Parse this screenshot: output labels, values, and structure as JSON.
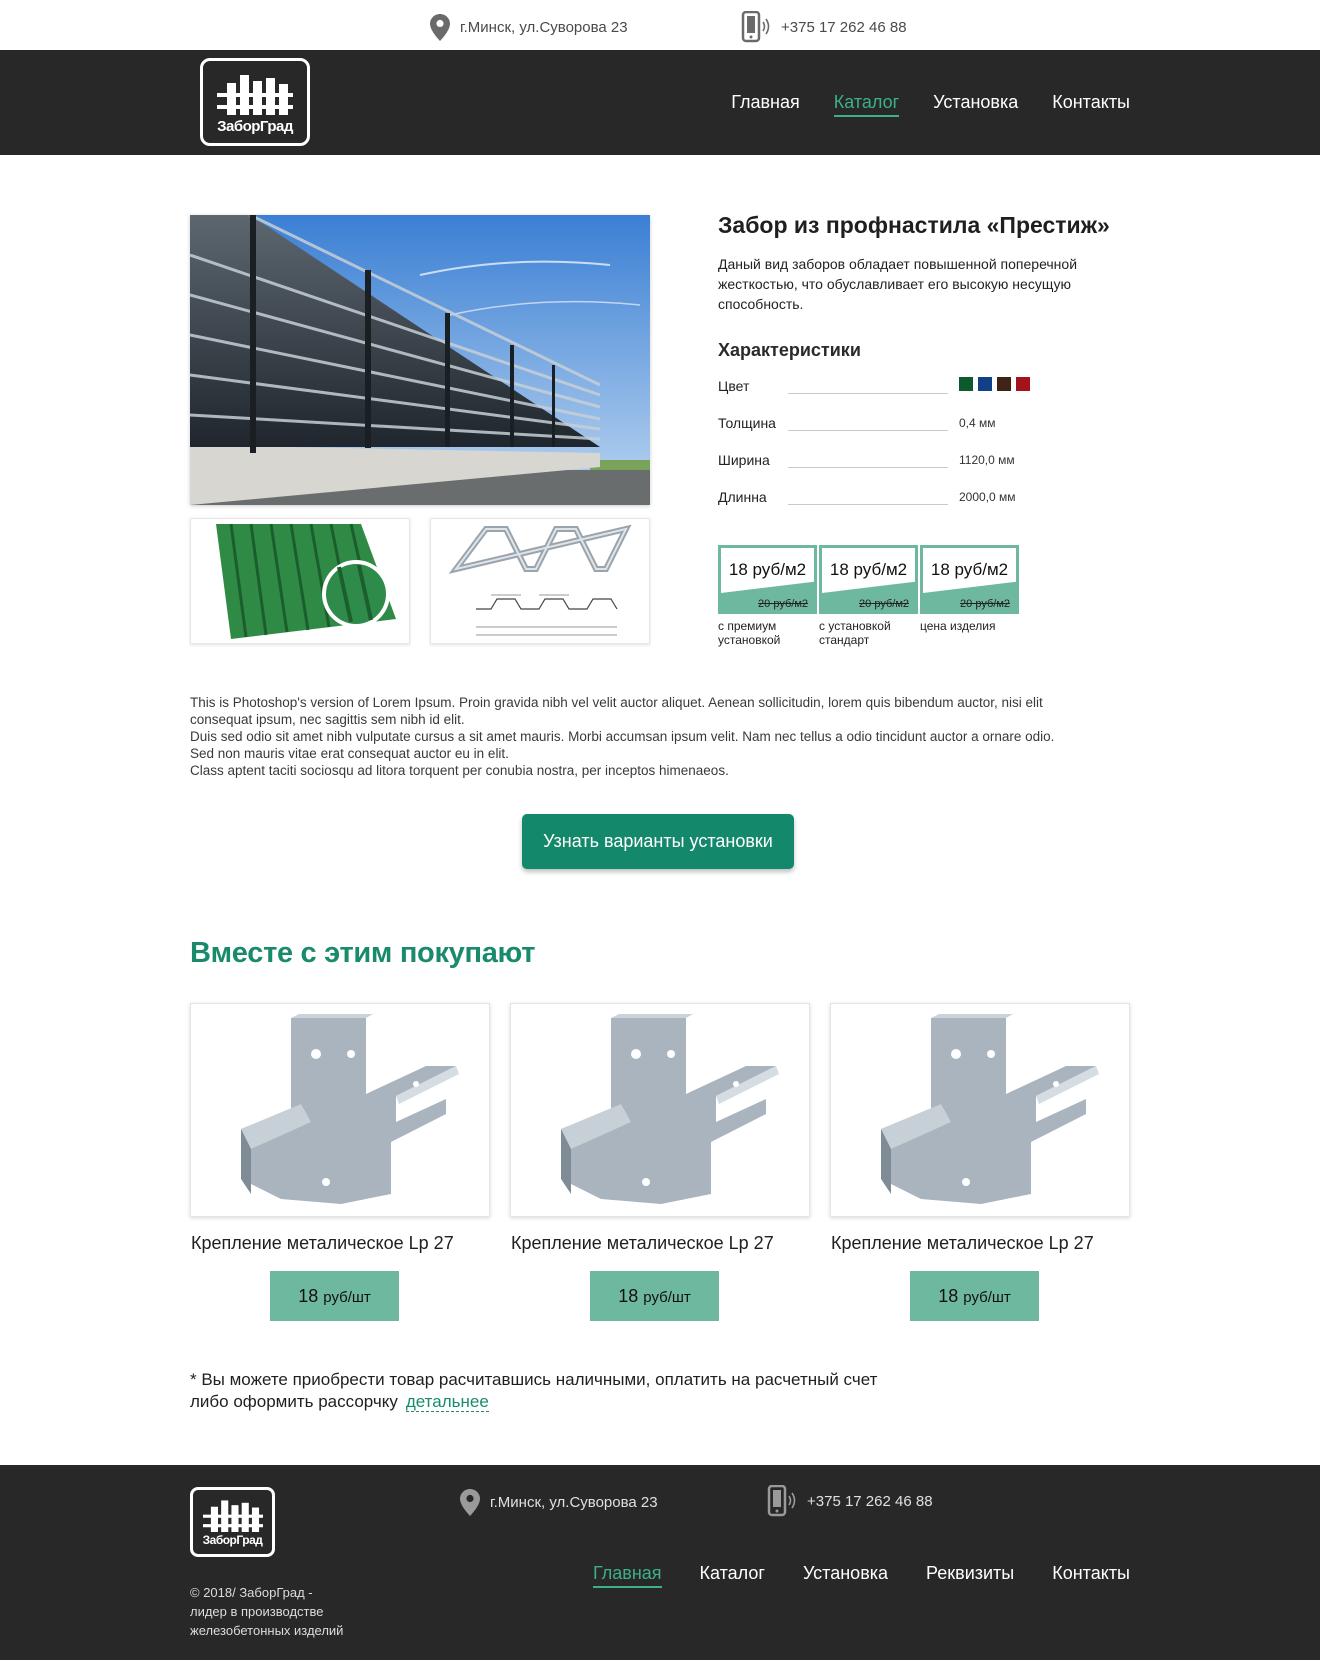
{
  "topbar": {
    "address": "г.Минск, ул.Суворова 23",
    "phone": "+375 17 262 46 88"
  },
  "logo": {
    "text": "ЗаборГрад"
  },
  "nav": [
    {
      "label": "Главная",
      "active": false
    },
    {
      "label": "Каталог",
      "active": true
    },
    {
      "label": "Установка",
      "active": false
    },
    {
      "label": "Контакты",
      "active": false
    }
  ],
  "product": {
    "title": "Забор из профнастила «Престиж»",
    "description": "Даный вид заборов обладает повышенной поперечной жесткостью, что обуславливает его высокую несущую способность.",
    "characteristics_title": "Характеристики",
    "specs": [
      {
        "key": "Цвет",
        "value": ""
      },
      {
        "key": "Толщина",
        "value": "0,4 мм"
      },
      {
        "key": "Ширина",
        "value": "1120,0 мм"
      },
      {
        "key": "Длинна",
        "value": "2000,0 мм"
      }
    ],
    "colors": [
      "#0f5a2c",
      "#123f8a",
      "#3d2414",
      "#a3121d"
    ],
    "prices": [
      {
        "value": "18 руб/м2",
        "old": "20 руб/м2",
        "label": "с премиум установкой"
      },
      {
        "value": "18 руб/м2",
        "old": "20 руб/м2",
        "label": "с установкой стандарт"
      },
      {
        "value": "18 руб/м2",
        "old": "20 руб/м2",
        "label": "цена изделия"
      }
    ],
    "lorem": [
      "This is Photoshop's version  of Lorem Ipsum. Proin gravida nibh vel velit auctor aliquet. Aenean sollicitudin, lorem quis bibendum auctor, nisi elit consequat ipsum, nec sagittis sem nibh id elit.",
      "Duis sed odio sit amet nibh vulputate cursus a sit amet mauris. Morbi accumsan ipsum velit. Nam nec tellus a odio tincidunt auctor a ornare odio. Sed non  mauris vitae erat consequat auctor eu in elit.",
      "Class aptent taciti sociosqu ad litora torquent per conubia nostra, per inceptos himenaeos."
    ],
    "cta": "Узнать варианты установки"
  },
  "related": {
    "title": "Вместе с этим покупают",
    "items": [
      {
        "name": "Крепление металическое Lp 27",
        "price_num": "18",
        "price_unit": "руб/шт"
      },
      {
        "name": "Крепление металическое Lp 27",
        "price_num": "18",
        "price_unit": "руб/шт"
      },
      {
        "name": "Крепление металическое Lp 27",
        "price_num": "18",
        "price_unit": "руб/шт"
      }
    ]
  },
  "note": {
    "line1": "* Вы можете приобрести товар расчитавшись наличными, оплатить на расчетный счет",
    "line2": "либо оформить рассорчку",
    "link": "детальнее"
  },
  "footer": {
    "logo_text": "ЗаборГрад",
    "copyright_lines": [
      "© 2018/ ЗаборГрад -",
      "лидер в производстве",
      "железобетонных изделий"
    ],
    "address": "г.Минск, ул.Суворова 23",
    "phone": "+375 17 262 46 88",
    "nav": [
      {
        "label": "Главная",
        "active": true
      },
      {
        "label": "Каталог",
        "active": false
      },
      {
        "label": "Установка",
        "active": false
      },
      {
        "label": "Реквизиты",
        "active": false
      },
      {
        "label": "Контакты",
        "active": false
      }
    ]
  },
  "icons": {
    "location": "location-pin-icon",
    "phone": "mobile-phone-icon"
  }
}
